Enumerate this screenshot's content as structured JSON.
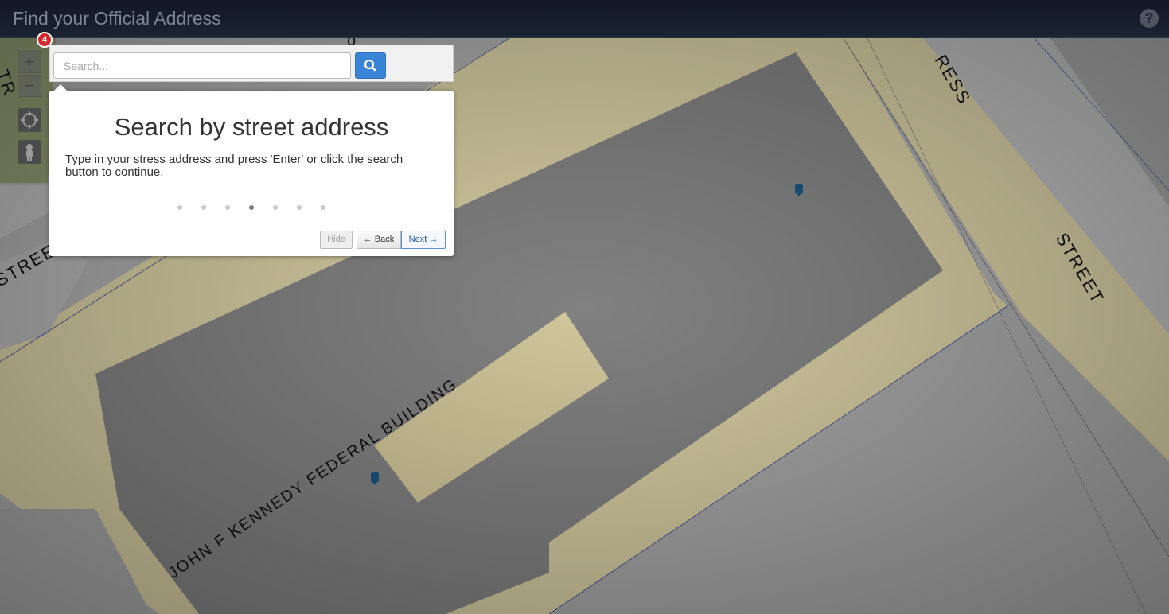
{
  "header": {
    "title": "Find your Official Address",
    "help_icon": "?"
  },
  "map_controls": {
    "zoom_in_label": "+",
    "zoom_out_label": "−",
    "locate_icon": "crosshair-icon",
    "streetview_icon": "pegman-icon"
  },
  "search": {
    "placeholder": "Search...",
    "button_icon": "search-icon"
  },
  "tour": {
    "step_number": "4",
    "title": "Search by street address",
    "body": "Type in your stress address and press 'Enter' or click the search button to continue.",
    "total_steps": 7,
    "current_step": 4,
    "hide_label": "Hide",
    "back_label": "← Back",
    "next_label": "Next →"
  },
  "map_labels": {
    "building": "JOHN  F  KENNEDY  FEDERAL  BUILDING",
    "street_right": "STREET",
    "street_left": "STREE",
    "road_top": "RESS",
    "road_top_left": "TR",
    "partial_top": "o"
  },
  "colors": {
    "header_bg": "#101824",
    "search_button": "#3a84d8",
    "badge": "#d9262c",
    "road": "#e9dfb0",
    "building": "#8a8a8a",
    "pin": "#1c5c8c"
  }
}
